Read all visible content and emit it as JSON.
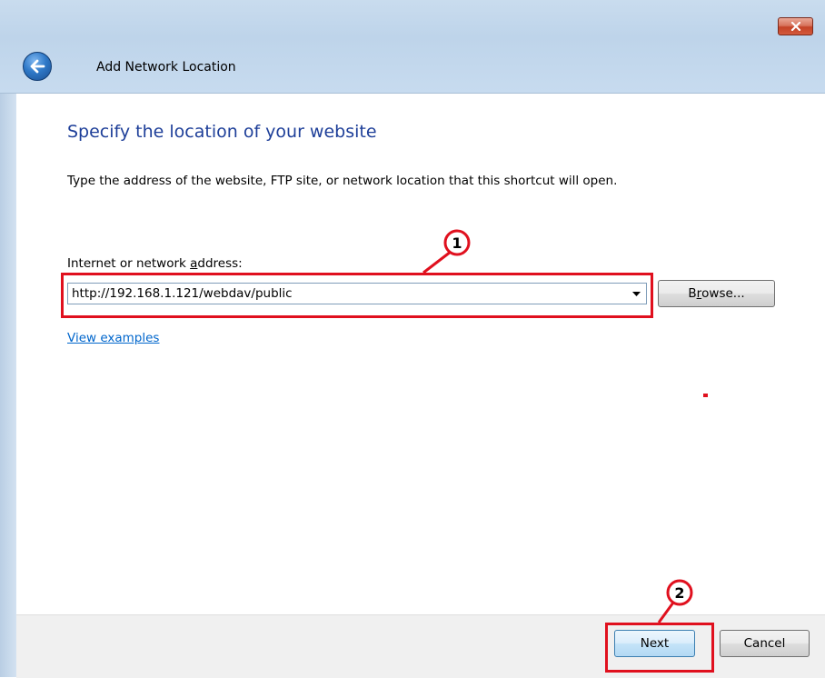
{
  "window": {
    "title": "Add Network Location",
    "close_icon": "close-icon",
    "back_icon": "back-arrow-icon"
  },
  "main": {
    "heading": "Specify the location of your website",
    "description": "Type the address of the website, FTP site, or network location that this shortcut will open.",
    "address_label_pre": "Internet or network ",
    "address_label_accel": "a",
    "address_label_post": "ddress:",
    "address_value": "http://192.168.1.121/webdav/public",
    "dropdown_icon": "chevron-down-icon",
    "browse_label_pre": "B",
    "browse_label_accel": "r",
    "browse_label_post": "owse...",
    "view_examples": "View examples"
  },
  "footer": {
    "next_label": "Next",
    "cancel_label": "Cancel"
  },
  "annotations": {
    "marker_1": "1",
    "marker_2": "2",
    "color": "#e0101e"
  },
  "colors": {
    "heading": "#1e3f99",
    "link": "#0066cc",
    "titlebar": "#c9dcee"
  }
}
